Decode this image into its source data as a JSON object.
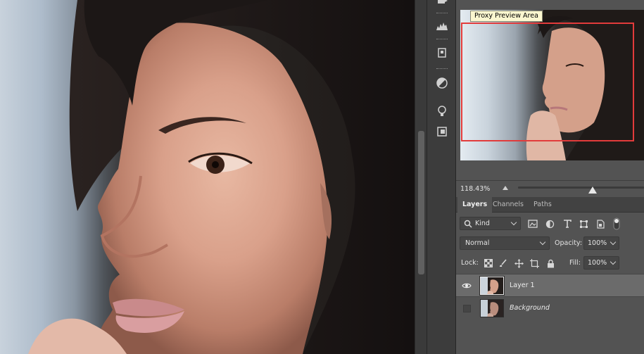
{
  "navigator": {
    "tooltip": "Proxy Preview Area",
    "zoom": "118.43%",
    "zoom_fraction": 0.59
  },
  "tabs": [
    {
      "label": "Layers",
      "active": true
    },
    {
      "label": "Channels",
      "active": false
    },
    {
      "label": "Paths",
      "active": false
    }
  ],
  "filter": {
    "kind_label": "Kind"
  },
  "blend": {
    "mode": "Normal",
    "opacity_label": "Opacity:",
    "opacity": "100%"
  },
  "lock": {
    "label": "Lock:",
    "fill_label": "Fill:",
    "fill": "100%"
  },
  "layers": [
    {
      "name": "Layer 1",
      "visible": true,
      "selected": true
    },
    {
      "name": "Background",
      "visible": false,
      "selected": false
    }
  ],
  "tools": [
    "move-icon",
    "histogram-icon",
    "3d-cube-icon",
    "adjustments-icon",
    "lightbulb-icon",
    "frame-icon"
  ],
  "colors": {
    "panel_bg": "#535353",
    "selected_layer": "#6b6b6b",
    "proxy_rect": "#e23b3b",
    "tooltip_bg": "#fbf7d0"
  }
}
